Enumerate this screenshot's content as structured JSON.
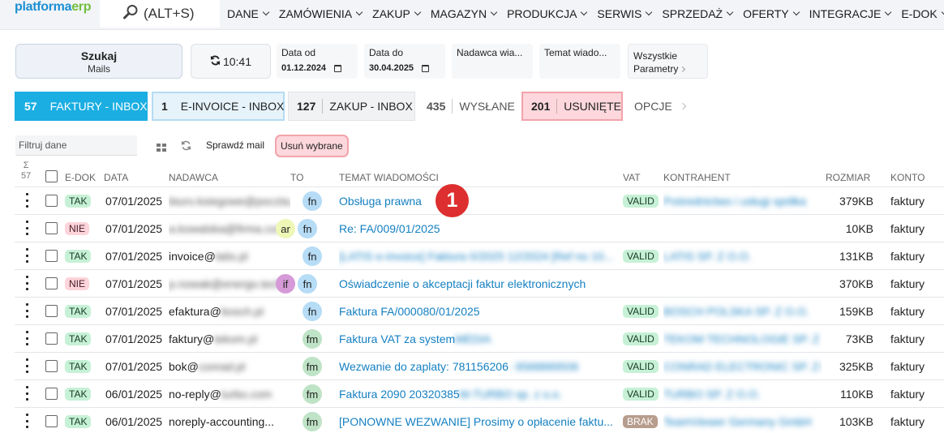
{
  "app": {
    "logo_main": "platforma",
    "logo_accent": "erp",
    "search_label": "(ALT+S)"
  },
  "menu": [
    {
      "label": "DANE"
    },
    {
      "label": "ZAMÓWIENIA"
    },
    {
      "label": "ZAKUP"
    },
    {
      "label": "MAGAZYN"
    },
    {
      "label": "PRODUKCJA"
    },
    {
      "label": "SERWIS"
    },
    {
      "label": "SPRZEDAŻ"
    },
    {
      "label": "OFERTY"
    },
    {
      "label": "INTEGRACJE"
    },
    {
      "label": "E-DOK"
    }
  ],
  "filters": {
    "search_button_title": "Szukaj",
    "search_button_sub": "Mails",
    "refresh_time": "10:41",
    "date_from_label": "Data od",
    "date_from_value": "01.12.2024",
    "date_to_label": "Data do",
    "date_to_value": "30.04.2025",
    "sender_label": "Nadawca wia...",
    "subject_label": "Temat wiado...",
    "params_line1": "Wszystkie",
    "params_line2": "Parametry"
  },
  "tabs": [
    {
      "count": "57",
      "label": "FAKTURY - INBOX"
    },
    {
      "count": "1",
      "label": "E-INVOICE - INBOX"
    },
    {
      "count": "127",
      "label": "ZAKUP - INBOX"
    },
    {
      "count": "435",
      "label": "WYSŁANE"
    },
    {
      "count": "201",
      "label": "USUNIĘTE"
    },
    {
      "count": "",
      "label": "OPCJE"
    }
  ],
  "toolbar": {
    "filter_placeholder": "Filtruj dane",
    "check_mail": "Sprawdź mail",
    "delete_selected": "Usuń wybrane"
  },
  "table": {
    "sigma": "Σ",
    "sigma_count": "57",
    "headers": {
      "edok": "E-DOK",
      "date": "DATA",
      "sender": "NADAWCA",
      "to": "TO",
      "subject": "TEMAT WIADOMOŚCI",
      "vat": "VAT",
      "contractor": "KONTRAHENT",
      "size": "ROZMIAR",
      "account": "KONTO"
    },
    "rows": [
      {
        "edok": "TAK",
        "date": "07/01/2025",
        "sender_visible": "",
        "sender_blur": "biuro.ksiegowe@poczta.pl",
        "to": [
          "fn"
        ],
        "subject": "Obsługa prawna",
        "subject_blur": "",
        "vat": "VALID",
        "contractor_blur": "Pośrednictwo i usługi spółka",
        "size": "379KB",
        "account": "faktury"
      },
      {
        "edok": "NIE",
        "date": "07/01/2025",
        "sender_visible": "",
        "sender_blur": "a.kowalska@firma.com.pl",
        "to": [
          "ar",
          "fn"
        ],
        "subject": "Re: FA/009/01/2025",
        "subject_blur": "",
        "vat": "",
        "contractor_blur": "",
        "size": "10KB",
        "account": "faktury"
      },
      {
        "edok": "TAK",
        "date": "07/01/2025",
        "sender_visible": "invoice@",
        "sender_blur": "latis.pl",
        "to": [
          "fn"
        ],
        "subject": "",
        "subject_blur": "[LATIS e-invoice] Faktura 0/2025 12/2024 [Ref no 10...",
        "vat": "VALID",
        "contractor_blur": "LATIS SP. Z O.O.",
        "size": "131KB",
        "account": "faktury"
      },
      {
        "edok": "NIE",
        "date": "07/01/2025",
        "sender_visible": "",
        "sender_blur": "p.nowak@energo.tech",
        "to": [
          "if",
          "fn"
        ],
        "subject": "Oświadczenie o akceptacji faktur elektronicznych",
        "subject_blur": "",
        "vat": "",
        "contractor_blur": "",
        "size": "370KB",
        "account": "faktury"
      },
      {
        "edok": "TAK",
        "date": "07/01/2025",
        "sender_visible": "efaktura@",
        "sender_blur": "bosch.pl",
        "to": [
          "fn"
        ],
        "subject": "Faktura FA/000080/01/2025",
        "subject_blur": "",
        "vat": "VALID",
        "contractor_blur": "BOSCH POLSKA SP. Z O.O.",
        "size": "159KB",
        "account": "faktury"
      },
      {
        "edok": "TAK",
        "date": "07/01/2025",
        "sender_visible": "faktury@",
        "sender_blur": "tekom.pl",
        "to": [
          "fm"
        ],
        "subject": "Faktura VAT za system ",
        "subject_blur": "MEDIA",
        "vat": "VALID",
        "contractor_blur": "TEKOM TECHNOLOGIE SP. Z",
        "size": "73KB",
        "account": "faktury"
      },
      {
        "edok": "TAK",
        "date": "07/01/2025",
        "sender_visible": "bok@",
        "sender_blur": "conrad.pl",
        "to": [
          "fm"
        ],
        "subject": "Wezwanie do zaplaty: 781156206 ",
        "subject_blur": "- 9568889506",
        "vat": "VALID",
        "contractor_blur": "CONRAD ELECTRONIC SP. Z O.O.",
        "size": "325KB",
        "account": "faktury"
      },
      {
        "edok": "TAK",
        "date": "06/01/2025",
        "sender_visible": "no-reply@",
        "sender_blur": "turbo.com",
        "to": [
          "fm"
        ],
        "subject": "Faktura 2090 20320385",
        "subject_blur": " M-TURBO sp. z o.o.",
        "vat": "VALID",
        "contractor_blur": "TURBO SP. Z O.O.",
        "size": "110KB",
        "account": "faktury"
      },
      {
        "edok": "TAK",
        "date": "06/01/2025",
        "sender_visible": "noreply-accounting...",
        "sender_blur": "",
        "to": [
          "fm"
        ],
        "subject": "[PONOWNE WEZWANIE] Prosimy o opłacenie faktu...",
        "subject_blur": "",
        "vat": "BRAK",
        "contractor_blur": "TeamViewer Germany GmbH",
        "size": "103KB",
        "account": "faktury"
      }
    ]
  },
  "marker": {
    "label": "1"
  }
}
